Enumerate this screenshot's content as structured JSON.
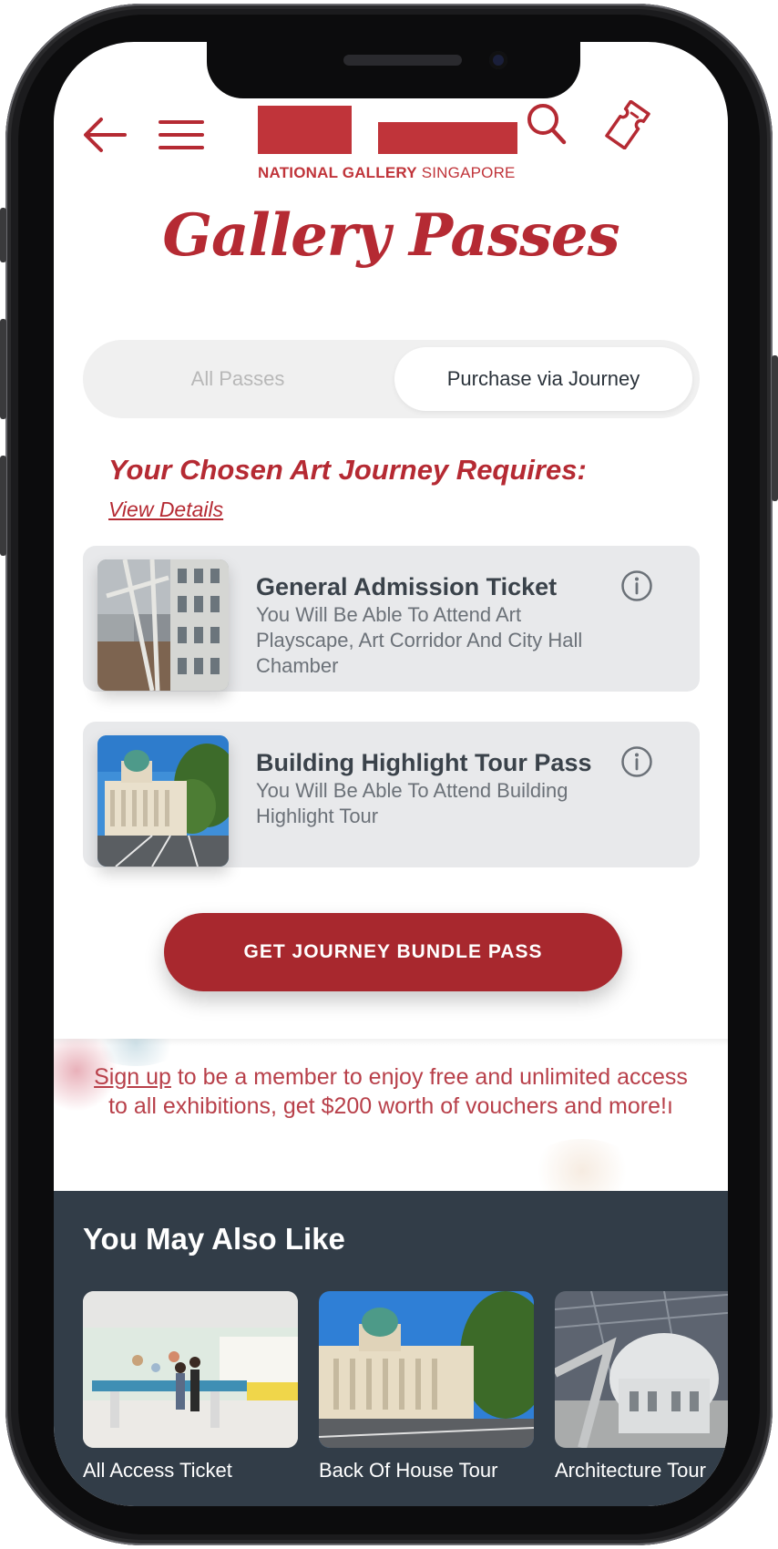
{
  "app": {
    "logo_text_bold": "NATIONAL GALLERY",
    "logo_text_regular": "SINGAPORE"
  },
  "header": {
    "icons": [
      "back-arrow-icon",
      "menu-icon",
      "search-icon",
      "ticket-icon"
    ]
  },
  "page": {
    "title": "Gallery Passes"
  },
  "tabs": [
    {
      "label": "All Passes",
      "selected": false
    },
    {
      "label": "Purchase via Journey",
      "selected": true
    }
  ],
  "journey": {
    "heading": "Your Chosen Art Journey Requires:",
    "view_details": "View Details"
  },
  "passes": [
    {
      "title": "General Admission Ticket",
      "description": "You Will Be Able To Attend Art Playscape, Art Corridor And City Hall Chamber",
      "image": "gallery-interior-photo"
    },
    {
      "title": "Building Highlight Tour Pass",
      "description": "You Will Be Able To Attend Building Highlight Tour",
      "image": "building-exterior-photo"
    }
  ],
  "cta": {
    "label": "GET JOURNEY BUNDLE PASS"
  },
  "signup_banner": {
    "link": "Sign up",
    "text": " to be a member to enjoy free and unlimited access to all exhibitions, get $200 worth of vouchers and more!ı"
  },
  "recommendations": {
    "title": "You May Also Like",
    "items": [
      {
        "label": "All Access Ticket",
        "image": "art-playscape-photo"
      },
      {
        "label": "Back Of House Tour",
        "image": "building-exterior-photo"
      },
      {
        "label": "Architecture Tour",
        "image": "dome-architecture-photo"
      }
    ]
  },
  "colors": {
    "brand_red": "#c0343a",
    "cta_red": "#a8282e",
    "card_grey": "#e8e9eb",
    "dark_section": "#323d48"
  }
}
